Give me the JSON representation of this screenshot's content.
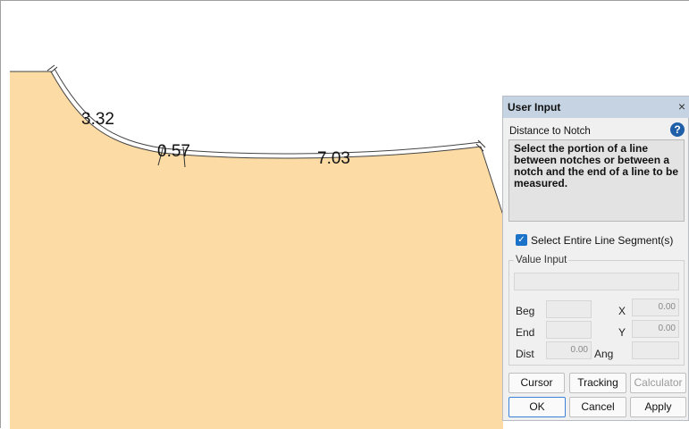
{
  "drawing": {
    "dimensions": [
      {
        "label": "3.32"
      },
      {
        "label": "0.57"
      },
      {
        "label": "7.03"
      }
    ],
    "colors": {
      "fill": "#fcdba4",
      "line": "#444444"
    }
  },
  "dialog": {
    "title": "User Input",
    "close_icon": "×",
    "mode": "Distance to Notch",
    "help_icon": "?",
    "instruction": "Select the portion of a line between notches or between a notch and the end of a line to be measured.",
    "select_entire_segment": {
      "label": "Select Entire Line Segment(s)",
      "checked": true
    },
    "value_input": {
      "legend": "Value Input",
      "beg_label": "Beg",
      "end_label": "End",
      "dist_label": "Dist",
      "x_label": "X",
      "y_label": "Y",
      "ang_label": "Ang",
      "beg_value": "",
      "end_value": "",
      "dist_value": "0.00",
      "x_value": "0.00",
      "y_value": "0.00",
      "ang_value": ""
    },
    "buttons": {
      "cursor": "Cursor",
      "tracking": "Tracking",
      "calculator": "Calculator",
      "ok": "OK",
      "cancel": "Cancel",
      "apply": "Apply"
    }
  }
}
